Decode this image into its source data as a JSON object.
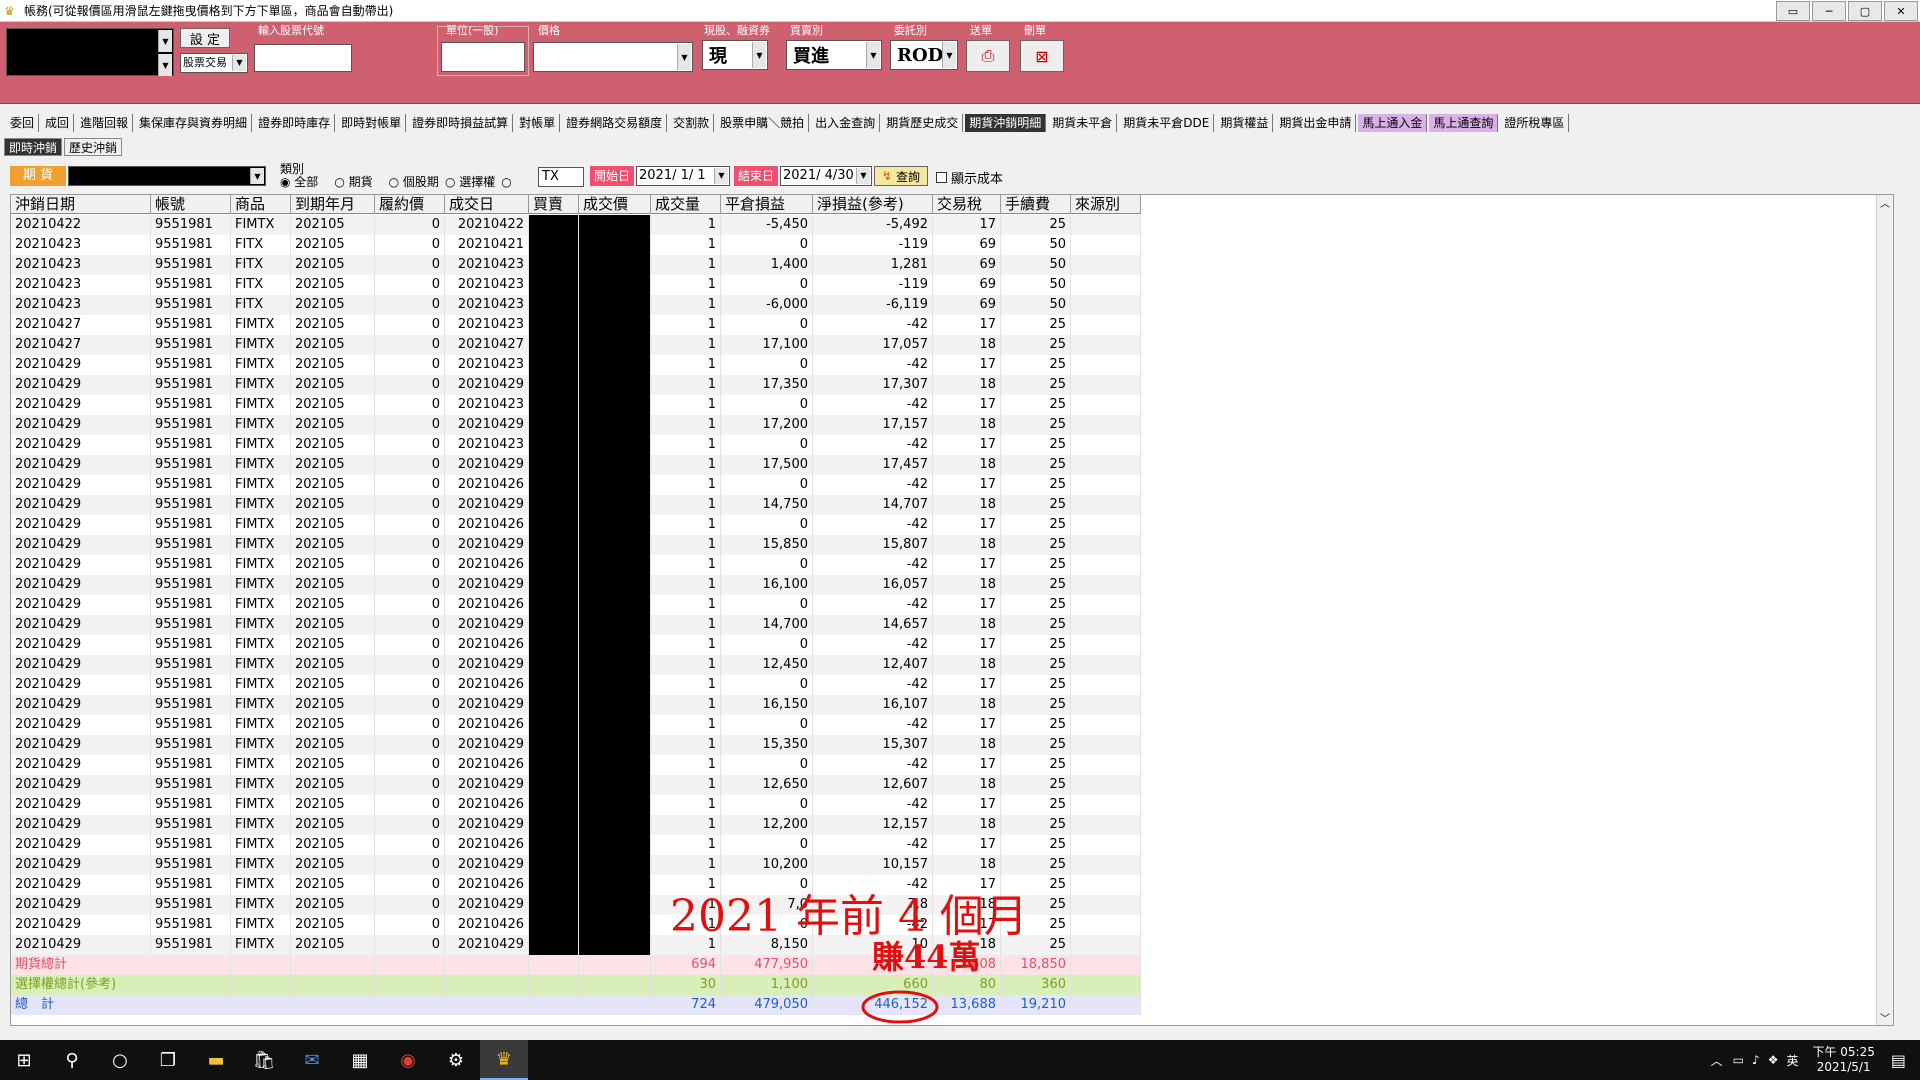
{
  "window": {
    "title": "帳務(可從報價區用滑鼠左鍵拖曳價格到下方下單區，商品會自動帶出)"
  },
  "order_panel": {
    "set_label": "設 定",
    "trade_type": "股票交易",
    "stock_code_label": "輸入股票代號",
    "unit_label": "單位(一股)",
    "price_label": "價格",
    "cash_margin_label": "現股、融資券",
    "cash_value": "現",
    "buy_sell_label": "買賣別",
    "buy_sell_value": "買進",
    "order_type_label": "委託別",
    "order_type_value": "ROD",
    "send_label": "送單",
    "delete_label": "刪單"
  },
  "tabs": [
    "委回",
    "成回",
    "進階回報",
    "集保庫存與資券明細",
    "證券即時庫存",
    "即時對帳單",
    "證券即時損益試算",
    "對帳單",
    "證券網路交易額度",
    "交割款",
    "股票申購＼競拍",
    "出入金查詢",
    "期貨歷史成交",
    "期貨沖銷明細",
    "期貨未平倉",
    "期貨未平倉DDE",
    "期貨權益",
    "期貨出金申請",
    "馬上通入金",
    "馬上通查詢",
    "證所稅專區"
  ],
  "subtabs": [
    "即時沖銷",
    "歷史沖銷"
  ],
  "filters": {
    "futures_label": "期 貨",
    "category_label": "類別",
    "radio_all": "全部",
    "radio_futures": "期貨",
    "radio_stock_futures": "個股期",
    "radio_options": "選擇權",
    "product_value": "TX",
    "start_label": "開始日",
    "start_value": "2021/ 1/ 1",
    "end_label": "結束日",
    "end_value": "2021/ 4/30",
    "query_label": "查詢",
    "show_cost_label": "顯示成本"
  },
  "table": {
    "columns": [
      "沖銷日期",
      "帳號",
      "商品",
      "到期年月",
      "履約價",
      "成交日",
      "買賣",
      "成交價",
      "成交量",
      "平倉損益",
      "淨損益(參考)",
      "交易稅",
      "手續費",
      "來源別"
    ],
    "rows": [
      [
        "20210422",
        "9551981",
        "FIMTX",
        "202105",
        "0",
        "20210422",
        "1",
        "-5,450",
        "-5,492",
        "17",
        "25"
      ],
      [
        "20210423",
        "9551981",
        "FITX",
        "202105",
        "0",
        "20210421",
        "1",
        "0",
        "-119",
        "69",
        "50"
      ],
      [
        "20210423",
        "9551981",
        "FITX",
        "202105",
        "0",
        "20210423",
        "1",
        "1,400",
        "1,281",
        "69",
        "50"
      ],
      [
        "20210423",
        "9551981",
        "FITX",
        "202105",
        "0",
        "20210423",
        "1",
        "0",
        "-119",
        "69",
        "50"
      ],
      [
        "20210423",
        "9551981",
        "FITX",
        "202105",
        "0",
        "20210423",
        "1",
        "-6,000",
        "-6,119",
        "69",
        "50"
      ],
      [
        "20210427",
        "9551981",
        "FIMTX",
        "202105",
        "0",
        "20210423",
        "1",
        "0",
        "-42",
        "17",
        "25"
      ],
      [
        "20210427",
        "9551981",
        "FIMTX",
        "202105",
        "0",
        "20210427",
        "1",
        "17,100",
        "17,057",
        "18",
        "25"
      ],
      [
        "20210429",
        "9551981",
        "FIMTX",
        "202105",
        "0",
        "20210423",
        "1",
        "0",
        "-42",
        "17",
        "25"
      ],
      [
        "20210429",
        "9551981",
        "FIMTX",
        "202105",
        "0",
        "20210429",
        "1",
        "17,350",
        "17,307",
        "18",
        "25"
      ],
      [
        "20210429",
        "9551981",
        "FIMTX",
        "202105",
        "0",
        "20210423",
        "1",
        "0",
        "-42",
        "17",
        "25"
      ],
      [
        "20210429",
        "9551981",
        "FIMTX",
        "202105",
        "0",
        "20210429",
        "1",
        "17,200",
        "17,157",
        "18",
        "25"
      ],
      [
        "20210429",
        "9551981",
        "FIMTX",
        "202105",
        "0",
        "20210423",
        "1",
        "0",
        "-42",
        "17",
        "25"
      ],
      [
        "20210429",
        "9551981",
        "FIMTX",
        "202105",
        "0",
        "20210429",
        "1",
        "17,500",
        "17,457",
        "18",
        "25"
      ],
      [
        "20210429",
        "9551981",
        "FIMTX",
        "202105",
        "0",
        "20210426",
        "1",
        "0",
        "-42",
        "17",
        "25"
      ],
      [
        "20210429",
        "9551981",
        "FIMTX",
        "202105",
        "0",
        "20210429",
        "1",
        "14,750",
        "14,707",
        "18",
        "25"
      ],
      [
        "20210429",
        "9551981",
        "FIMTX",
        "202105",
        "0",
        "20210426",
        "1",
        "0",
        "-42",
        "17",
        "25"
      ],
      [
        "20210429",
        "9551981",
        "FIMTX",
        "202105",
        "0",
        "20210429",
        "1",
        "15,850",
        "15,807",
        "18",
        "25"
      ],
      [
        "20210429",
        "9551981",
        "FIMTX",
        "202105",
        "0",
        "20210426",
        "1",
        "0",
        "-42",
        "17",
        "25"
      ],
      [
        "20210429",
        "9551981",
        "FIMTX",
        "202105",
        "0",
        "20210429",
        "1",
        "16,100",
        "16,057",
        "18",
        "25"
      ],
      [
        "20210429",
        "9551981",
        "FIMTX",
        "202105",
        "0",
        "20210426",
        "1",
        "0",
        "-42",
        "17",
        "25"
      ],
      [
        "20210429",
        "9551981",
        "FIMTX",
        "202105",
        "0",
        "20210429",
        "1",
        "14,700",
        "14,657",
        "18",
        "25"
      ],
      [
        "20210429",
        "9551981",
        "FIMTX",
        "202105",
        "0",
        "20210426",
        "1",
        "0",
        "-42",
        "17",
        "25"
      ],
      [
        "20210429",
        "9551981",
        "FIMTX",
        "202105",
        "0",
        "20210429",
        "1",
        "12,450",
        "12,407",
        "18",
        "25"
      ],
      [
        "20210429",
        "9551981",
        "FIMTX",
        "202105",
        "0",
        "20210426",
        "1",
        "0",
        "-42",
        "17",
        "25"
      ],
      [
        "20210429",
        "9551981",
        "FIMTX",
        "202105",
        "0",
        "20210429",
        "1",
        "16,150",
        "16,107",
        "18",
        "25"
      ],
      [
        "20210429",
        "9551981",
        "FIMTX",
        "202105",
        "0",
        "20210426",
        "1",
        "0",
        "-42",
        "17",
        "25"
      ],
      [
        "20210429",
        "9551981",
        "FIMTX",
        "202105",
        "0",
        "20210429",
        "1",
        "15,350",
        "15,307",
        "18",
        "25"
      ],
      [
        "20210429",
        "9551981",
        "FIMTX",
        "202105",
        "0",
        "20210426",
        "1",
        "0",
        "-42",
        "17",
        "25"
      ],
      [
        "20210429",
        "9551981",
        "FIMTX",
        "202105",
        "0",
        "20210429",
        "1",
        "12,650",
        "12,607",
        "18",
        "25"
      ],
      [
        "20210429",
        "9551981",
        "FIMTX",
        "202105",
        "0",
        "20210426",
        "1",
        "0",
        "-42",
        "17",
        "25"
      ],
      [
        "20210429",
        "9551981",
        "FIMTX",
        "202105",
        "0",
        "20210429",
        "1",
        "12,200",
        "12,157",
        "18",
        "25"
      ],
      [
        "20210429",
        "9551981",
        "FIMTX",
        "202105",
        "0",
        "20210426",
        "1",
        "0",
        "-42",
        "17",
        "25"
      ],
      [
        "20210429",
        "9551981",
        "FIMTX",
        "202105",
        "0",
        "20210429",
        "1",
        "10,200",
        "10,157",
        "18",
        "25"
      ],
      [
        "20210429",
        "9551981",
        "FIMTX",
        "202105",
        "0",
        "20210426",
        "1",
        "0",
        "-42",
        "17",
        "25"
      ],
      [
        "20210429",
        "9551981",
        "FIMTX",
        "202105",
        "0",
        "20210429",
        "1",
        "7,0",
        "7,8",
        "18",
        "25"
      ],
      [
        "20210429",
        "9551981",
        "FIMTX",
        "202105",
        "0",
        "20210426",
        "1",
        "0",
        "-42",
        "17",
        "25"
      ],
      [
        "20210429",
        "9551981",
        "FIMTX",
        "202105",
        "0",
        "20210429",
        "1",
        "8,150",
        "10",
        "18",
        "25"
      ]
    ],
    "summary": [
      {
        "label": "期貨總計",
        "qty": "694",
        "pnl": "477,950",
        "net": "",
        "tax": "608",
        "fee": "18,850"
      },
      {
        "label": "選擇權總計(參考)",
        "qty": "30",
        "pnl": "1,100",
        "net": "660",
        "tax": "80",
        "fee": "360"
      },
      {
        "label": "總　計",
        "qty": "724",
        "pnl": "479,050",
        "net": "446,152",
        "tax": "13,688",
        "fee": "19,210"
      }
    ]
  },
  "annotation": {
    "line1": "2021 年前 4 個月",
    "line2": "賺44萬"
  },
  "taskbar": {
    "time": "下午 05:25",
    "date": "2021/5/1",
    "ime": "英"
  },
  "colors": {
    "panel": "#cf6070",
    "annotation": "#e01010"
  }
}
